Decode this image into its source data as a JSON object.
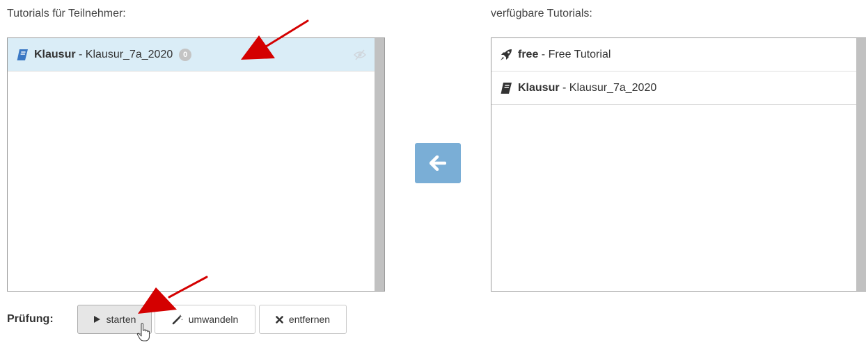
{
  "left_panel": {
    "title": "Tutorials für Teilnehmer:",
    "items": [
      {
        "name": "Klausur",
        "separator": " - ",
        "description": "Klausur_7a_2020",
        "badge": "0",
        "icon": "book-icon",
        "selected": true,
        "visibility_icon": "eye-slash-icon"
      }
    ]
  },
  "right_panel": {
    "title": "verfügbare Tutorials:",
    "items": [
      {
        "name": "free",
        "separator": " - ",
        "description": "Free Tutorial",
        "icon": "rocket-icon"
      },
      {
        "name": "Klausur",
        "separator": " - ",
        "description": "Klausur_7a_2020",
        "icon": "book-icon"
      }
    ]
  },
  "move_button": {
    "icon": "arrow-left-icon"
  },
  "exam": {
    "label": "Prüfung:",
    "buttons": {
      "start": {
        "label": "starten",
        "icon": "play-icon"
      },
      "convert": {
        "label": "umwandeln",
        "icon": "magic-wand-icon"
      },
      "remove": {
        "label": "entfernen",
        "icon": "times-icon"
      }
    }
  },
  "colors": {
    "selected_row": "#daedf7",
    "move_button": "#7aaed6",
    "book_icon_selected": "#3a78c4",
    "annotation_arrow": "#d40000"
  }
}
